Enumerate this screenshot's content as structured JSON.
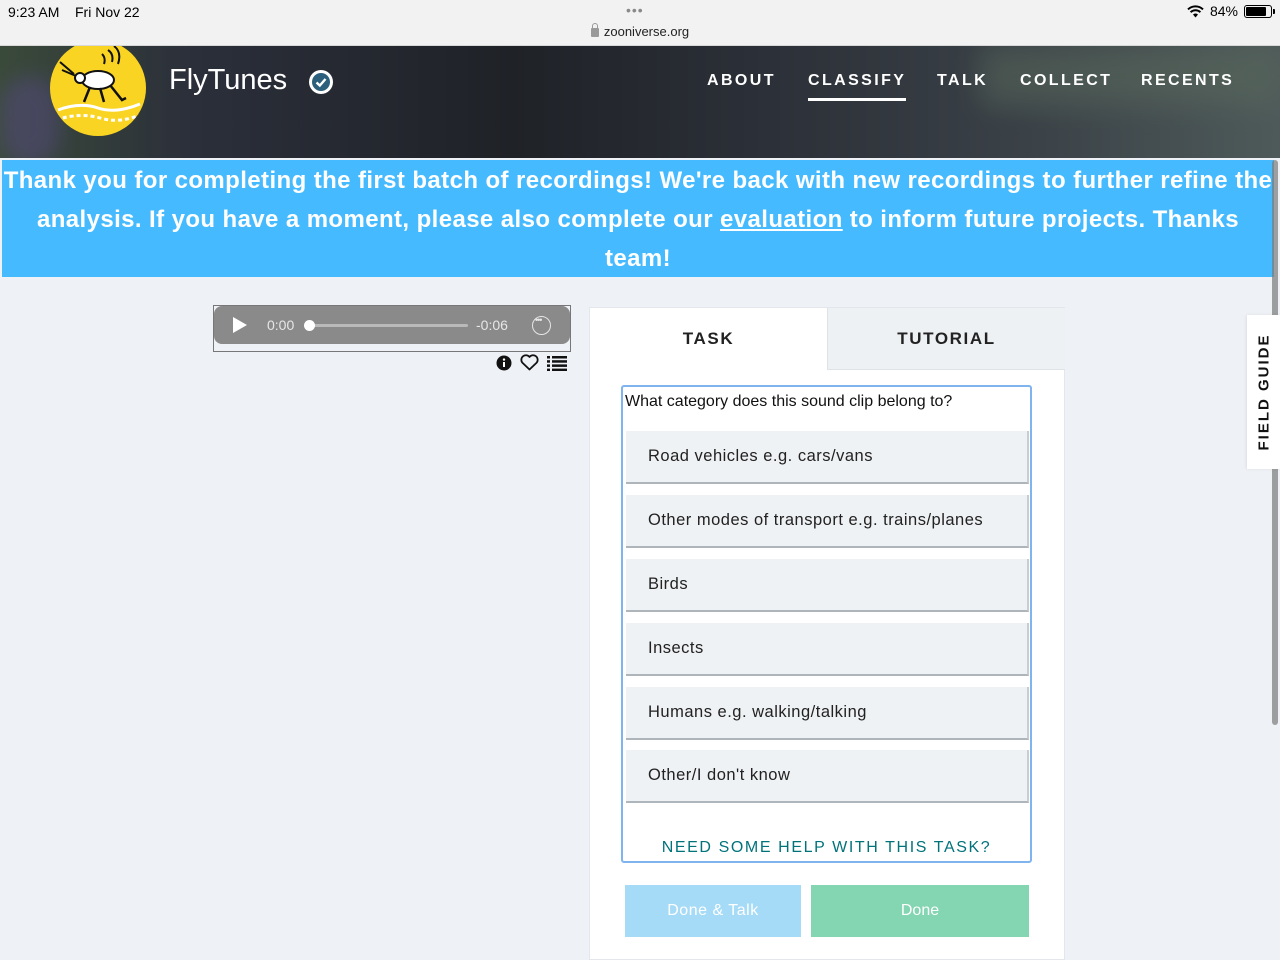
{
  "status_bar": {
    "time": "9:23 AM",
    "date": "Fri Nov 22",
    "url": "zooniverse.org",
    "battery": "84%",
    "battery_level": 0.84
  },
  "header": {
    "project_title": "FlyTunes",
    "nav": [
      {
        "label": "ABOUT",
        "active": false
      },
      {
        "label": "CLASSIFY",
        "active": true
      },
      {
        "label": "TALK",
        "active": false
      },
      {
        "label": "COLLECT",
        "active": false
      },
      {
        "label": "RECENTS",
        "active": false
      }
    ]
  },
  "banner": {
    "text_before": "Thank you for completing the first batch of recordings! We're back with new recordings to further refine the analysis. If you have a moment, please also complete our ",
    "link": "evaluation",
    "text_after": " to inform future projects. Thanks team!"
  },
  "audio": {
    "current_time": "0:00",
    "remaining_time": "-0:06",
    "progress": 0
  },
  "tabs": {
    "task": "TASK",
    "tutorial": "TUTORIAL"
  },
  "task": {
    "question": "What category does this sound clip belong to?",
    "answers": [
      "Road vehicles e.g. cars/vans",
      "Other modes of transport e.g. trains/planes",
      "Birds",
      "Insects",
      "Humans e.g. walking/talking",
      "Other/I don't know"
    ],
    "help": "NEED SOME HELP WITH THIS TASK?"
  },
  "buttons": {
    "done_talk": "Done & Talk",
    "done": "Done"
  },
  "field_guide": "FIELD GUIDE",
  "colors": {
    "banner": "#45baff",
    "done": "#84d5b1",
    "done_talk": "#a6dbf8",
    "help_link": "#00737a",
    "logo": "#f9d423"
  }
}
